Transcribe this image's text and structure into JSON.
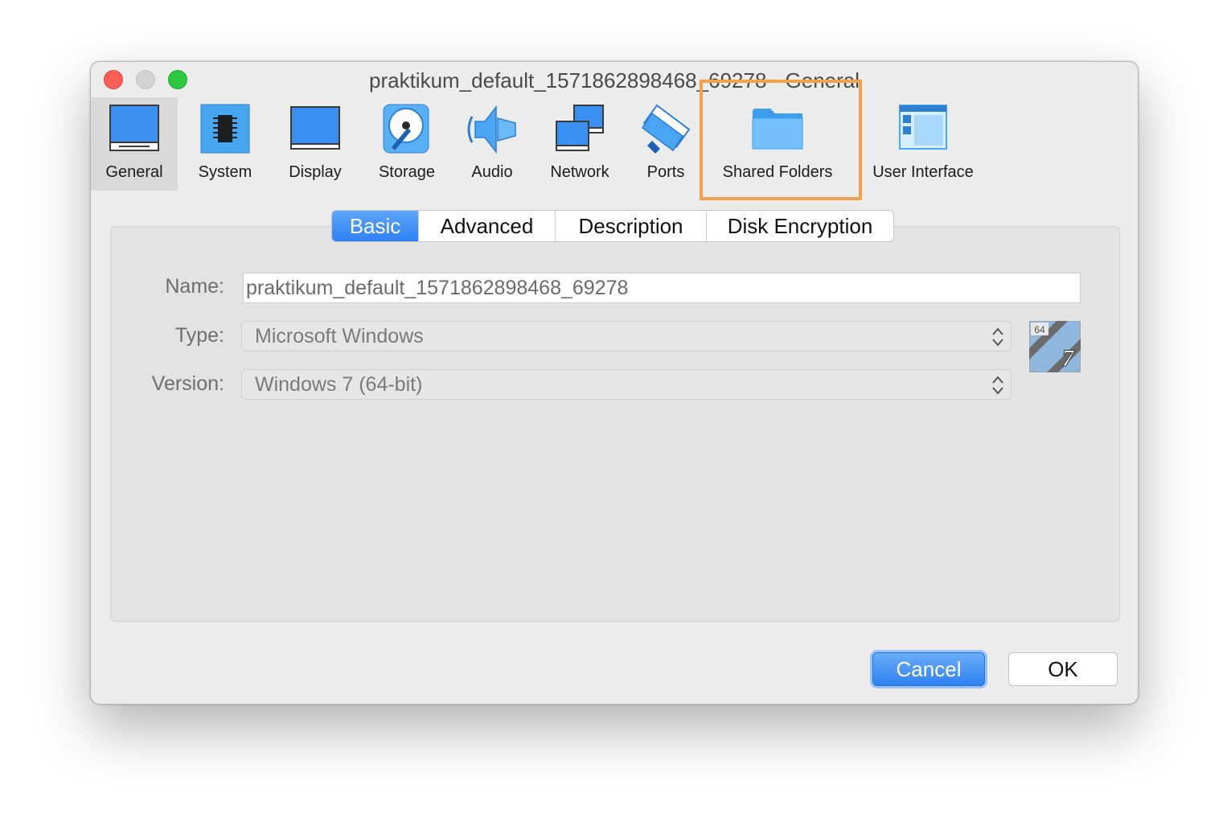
{
  "window": {
    "title": "praktikum_default_1571862898468_69278 - General"
  },
  "toolbar": {
    "items": [
      {
        "label": "General",
        "icon": "general-icon"
      },
      {
        "label": "System",
        "icon": "chip-icon"
      },
      {
        "label": "Display",
        "icon": "monitor-icon"
      },
      {
        "label": "Storage",
        "icon": "disk-icon"
      },
      {
        "label": "Audio",
        "icon": "speaker-icon"
      },
      {
        "label": "Network",
        "icon": "network-icon"
      },
      {
        "label": "Ports",
        "icon": "plug-icon"
      },
      {
        "label": "Shared Folders",
        "icon": "folder-icon"
      },
      {
        "label": "User Interface",
        "icon": "window-layout-icon"
      }
    ],
    "selected": "General",
    "highlighted": "Shared Folders",
    "highlight_color": "#f5a04a"
  },
  "tabs": [
    "Basic",
    "Advanced",
    "Description",
    "Disk Encryption"
  ],
  "active_tab": "Basic",
  "form": {
    "name_label": "Name:",
    "name_value": "praktikum_default_1571862898468_69278",
    "type_label": "Type:",
    "type_value": "Microsoft Windows",
    "version_label": "Version:",
    "version_value": "Windows 7 (64-bit)",
    "os_icon_text": "64",
    "os_icon_version": "7"
  },
  "buttons": {
    "cancel": "Cancel",
    "ok": "OK"
  },
  "colors": {
    "accent": "#2f81f4",
    "window_bg": "#ececec"
  }
}
